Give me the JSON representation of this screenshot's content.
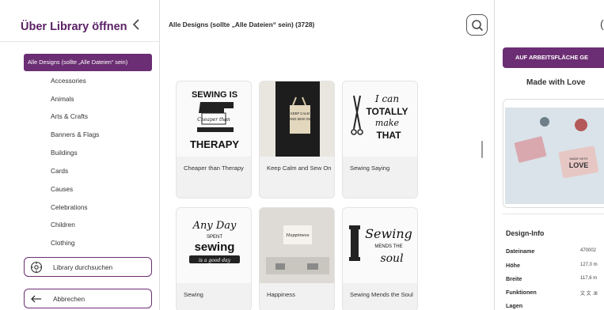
{
  "left_panel": {
    "title": "Über Library öffnen",
    "back_icon": "chevron-left-icon",
    "categories": {
      "active": "Alle Designs (sollte „Alle Dateien“ sein)",
      "items": [
        "Accessories",
        "Animals",
        "Arts & Crafts",
        "Banners & Flags",
        "Buildings",
        "Cards",
        "Causes",
        "Celebrations",
        "Children",
        "Clothing"
      ]
    },
    "search_library_button": {
      "label": "Library durchsuchen",
      "icon": "search-library-icon"
    },
    "cancel_button": {
      "label": "Abbrechen",
      "icon": "arrow-left-icon"
    }
  },
  "main": {
    "title": "Alle Designs (sollte „Alle Dateien“ sein) (3728)",
    "search_icon": "search-icon",
    "designs": [
      {
        "label": "Cheaper than Therapy",
        "art": [
          "SEWING IS",
          "Cheaper than",
          "THERAPY"
        ]
      },
      {
        "label": "Keep Calm and Sew On",
        "art": [
          "KEEP CALM",
          "AND SEW ON"
        ]
      },
      {
        "label": "Sewing Saying",
        "art": [
          "I can",
          "TOTALLY",
          "make",
          "THAT"
        ]
      },
      {
        "label": "Sewing",
        "art": [
          "Any Day",
          "SPENT",
          "sewing",
          "is a good day"
        ]
      },
      {
        "label": "Happiness",
        "art": [
          "Happiness"
        ]
      },
      {
        "label": "Sewing Mends the Soul",
        "art": [
          "Sewing",
          "MENDS THE",
          "soul"
        ]
      }
    ]
  },
  "right_panel": {
    "apply_button": "AUF ARBEITSFLÄCHE GE",
    "product_name": "Made with Love",
    "product_art": [
      "MADE WITH",
      "LOVE"
    ],
    "design_info": {
      "title": "Design-Info",
      "rows": [
        {
          "key": "Dateiname",
          "value": "470002"
        },
        {
          "key": "Höhe",
          "value": "127,0 m"
        },
        {
          "key": "Breite",
          "value": "117,6 m"
        },
        {
          "key": "Funktionen",
          "value": "文 文 .ꕤ"
        },
        {
          "key": "Lagen",
          "value": ""
        }
      ]
    }
  },
  "colors": {
    "accent": "#6b2d73",
    "title_purple": "#5b2266"
  }
}
